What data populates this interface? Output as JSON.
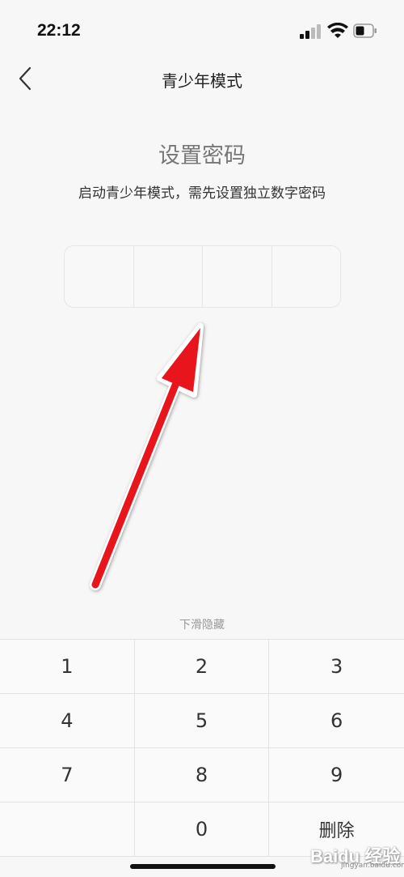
{
  "status_bar": {
    "time": "22:12",
    "signal_icon": "signal-icon",
    "wifi_icon": "wifi-icon",
    "battery_icon": "battery-icon"
  },
  "nav": {
    "back_icon": "chevron-left-icon",
    "title": "青少年模式"
  },
  "main": {
    "heading": "设置密码",
    "subtitle": "启动青少年模式，需先设置独立数字密码",
    "pin_length": 4
  },
  "keypad": {
    "hide_hint": "下滑隐藏",
    "keys": [
      "1",
      "2",
      "3",
      "4",
      "5",
      "6",
      "7",
      "8",
      "9",
      "",
      "0",
      "删除"
    ]
  },
  "annotation": {
    "arrow_color": "#e8141b"
  },
  "watermark": {
    "text": "Baidu 经验",
    "url": "jingyan.baidu.com"
  }
}
